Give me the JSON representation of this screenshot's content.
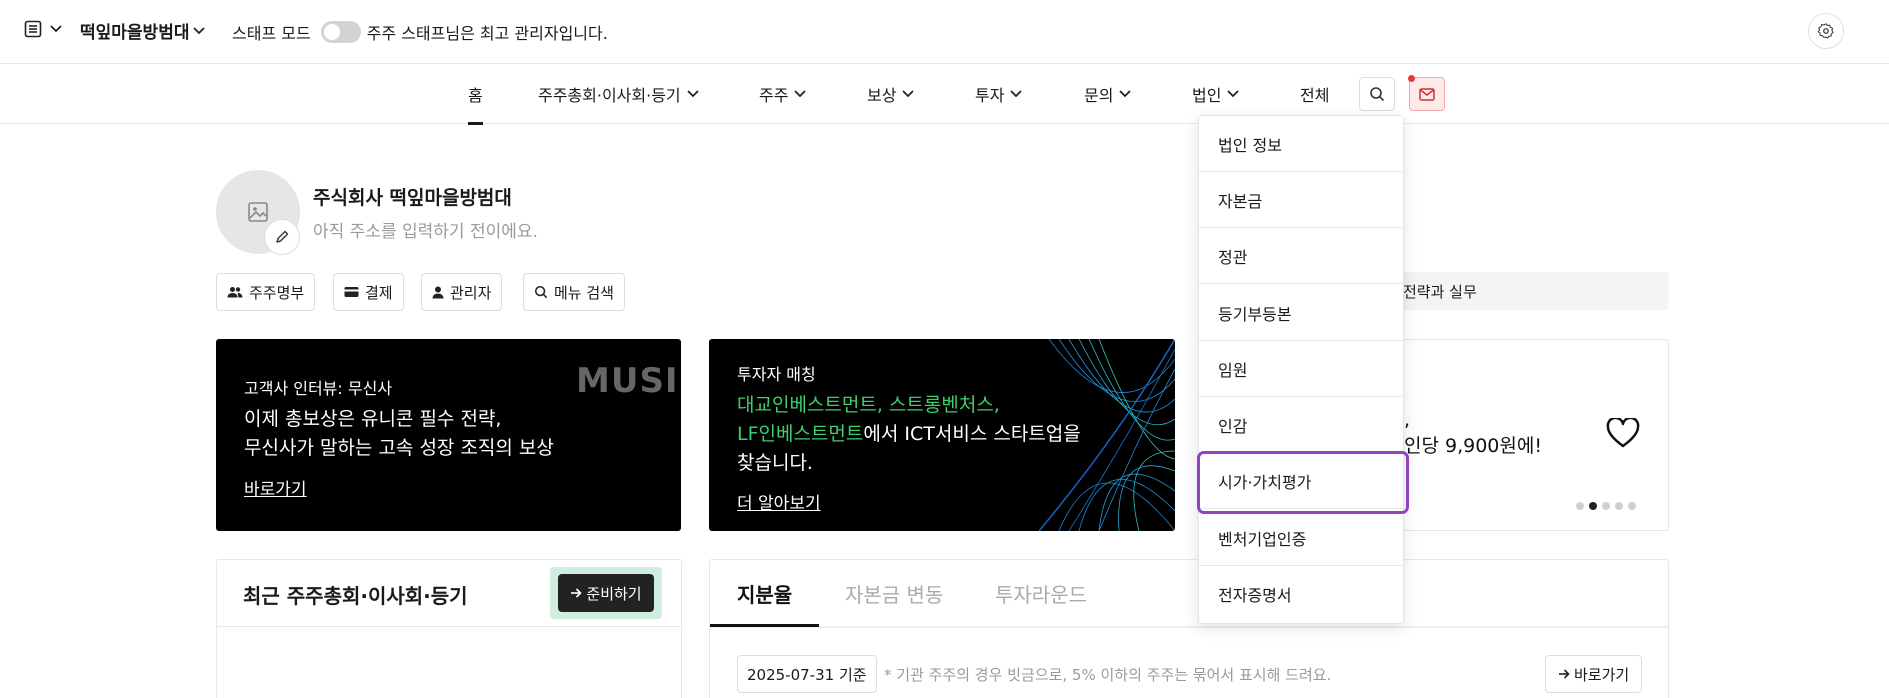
{
  "topbar": {
    "company_name": "떡잎마을방범대",
    "staff_mode_label": "스태프 모드",
    "admin_notice": "주주 스태프님은 최고 관리자입니다."
  },
  "nav": {
    "items": [
      {
        "label": "홈",
        "active": true
      },
      {
        "label": "주주총회·이사회·등기"
      },
      {
        "label": "주주"
      },
      {
        "label": "보상"
      },
      {
        "label": "투자"
      },
      {
        "label": "문의"
      },
      {
        "label": "법인"
      },
      {
        "label": "전체"
      }
    ]
  },
  "profile": {
    "name": "주식회사 떡잎마을방범대",
    "address_placeholder": "아직 주소를 입력하기 전이에요."
  },
  "quick_buttons": [
    {
      "label": "주주명부",
      "icon": "users-icon"
    },
    {
      "label": "결제",
      "icon": "card-icon"
    },
    {
      "label": "관리자",
      "icon": "user-icon"
    },
    {
      "label": "메뉴 검색",
      "icon": "search-icon"
    }
  ],
  "strip_text": "전략과 실무",
  "banners": {
    "b1": {
      "sub": "고객사 인터뷰: 무신사",
      "title_line1": "이제 총보상은 유니콘 필수 전략,",
      "title_line2": "무신사가 말하는 고속 성장 조직의 보상",
      "link": "바로가기",
      "logo_text": "MUSIN"
    },
    "b2": {
      "sub": "투자자 매칭",
      "green_line1": "대교인베스트먼트, 스트롱벤처스,",
      "green_line2": "LF인베스트먼트",
      "white_line2": "에서 ICT서비스 스타트업을",
      "line3": "찾습니다.",
      "link": "더 알아보기"
    },
    "b3": {
      "line1": ",",
      "line2": "인당 9,900원에!"
    }
  },
  "card1": {
    "title": "최근 주주총회·이사회·등기",
    "button": "준비하기"
  },
  "card2": {
    "tabs": [
      "지분율",
      "자본금 변동",
      "투자라운드"
    ],
    "date_chip": "2025-07-31 기준",
    "note": "* 기관 주주의 경우 빗금으로, 5% 이하의 주주는 묶어서 표시해 드려요.",
    "goto": "바로가기"
  },
  "dropdown": {
    "items": [
      "법인 정보",
      "자본금",
      "정관",
      "등기부등본",
      "임원",
      "인감",
      "시가·가치평가",
      "벤처기업인증",
      "전자증명서"
    ],
    "highlighted_index": 6,
    "highlight_color": "#8e44c5"
  },
  "colors": {
    "accent_green": "#3ecf6a",
    "highlight": "#8e44c5",
    "mail_bg": "#fdeaea"
  }
}
